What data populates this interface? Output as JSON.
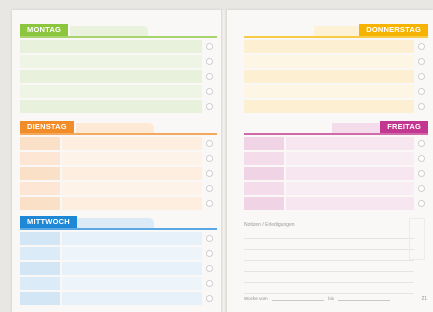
{
  "planner": {
    "days": [
      {
        "key": "montag",
        "label": "MONTAG",
        "accent": "#8cc63f",
        "tint": "#e3efd3",
        "rule": "#a7d46c"
      },
      {
        "key": "dienstag",
        "label": "DIENSTAG",
        "accent": "#f28c28",
        "tint": "#fbe2cc",
        "rule": "#f5a95c"
      },
      {
        "key": "mittwoch",
        "label": "MITTWOCH",
        "accent": "#1e88d6",
        "tint": "#cfe5f6",
        "rule": "#5aa9e4"
      },
      {
        "key": "donnerstag",
        "label": "DONNERSTAG",
        "accent": "#f6b400",
        "tint": "#fdefcc",
        "rule": "#f8cb45"
      },
      {
        "key": "freitag",
        "label": "FREITAG",
        "accent": "#c2378f",
        "tint": "#f2d5e6",
        "rule": "#d06aab"
      }
    ],
    "notes_label": "Notizen / Erledigungen",
    "footer": {
      "from": "Woche vom",
      "to": "bis"
    },
    "page_number": "21"
  }
}
